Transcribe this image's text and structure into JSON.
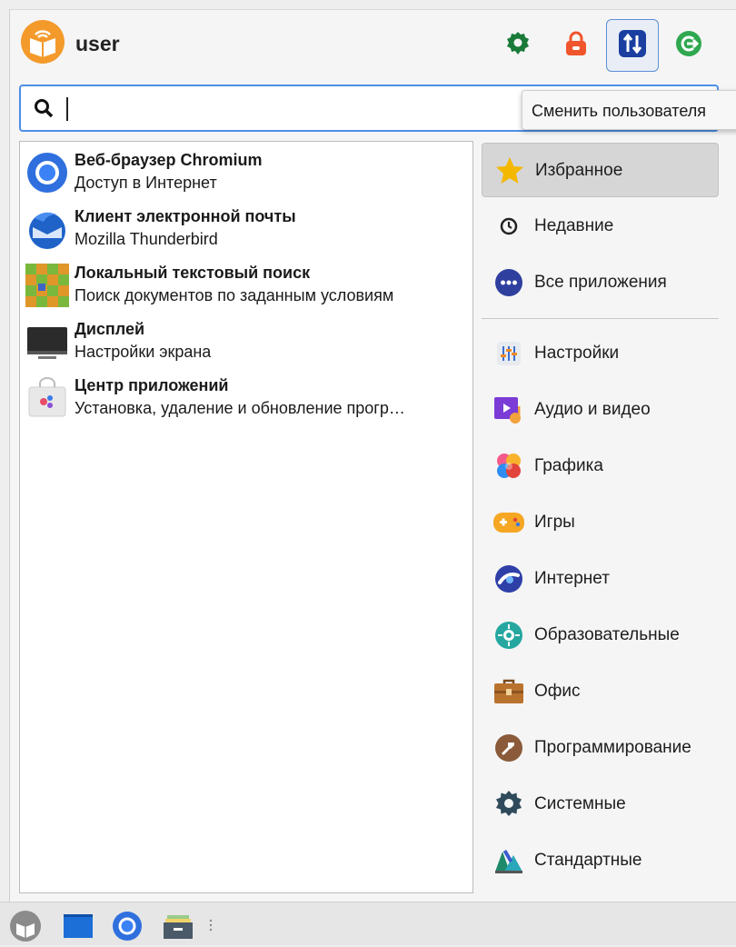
{
  "header": {
    "username": "user",
    "buttons": [
      {
        "icon": "settings-gear-icon",
        "color": "#1a7a3a"
      },
      {
        "icon": "lock-icon",
        "color": "#f0552c"
      },
      {
        "icon": "switch-user-icon",
        "color": "#1a3fa0"
      },
      {
        "icon": "logout-icon",
        "color": "#2fa84f"
      }
    ],
    "tooltip": "Сменить пользователя"
  },
  "search": {
    "value": "",
    "placeholder": ""
  },
  "apps": [
    {
      "name": "Веб-браузер Chromium",
      "description": "Доступ в Интернет",
      "icon": "chromium-icon"
    },
    {
      "name": "Клиент электронной почты",
      "description": "Mozilla Thunderbird",
      "icon": "thunderbird-icon"
    },
    {
      "name": "Локальный текстовый поиск",
      "description": "Поиск документов по заданным условиям",
      "icon": "recoll-icon"
    },
    {
      "name": "Дисплей",
      "description": "Настройки экрана",
      "icon": "display-icon"
    },
    {
      "name": "Центр приложений",
      "description": "Установка, удаление и обновление прогр…",
      "icon": "app-center-icon"
    }
  ],
  "categories_top": [
    {
      "label": "Избранное",
      "icon": "star-icon",
      "selected": true
    },
    {
      "label": "Недавние",
      "icon": "clock-icon"
    },
    {
      "label": "Все приложения",
      "icon": "all-apps-icon"
    }
  ],
  "categories": [
    {
      "label": "Настройки",
      "icon": "settings-icon"
    },
    {
      "label": "Аудио и видео",
      "icon": "multimedia-icon"
    },
    {
      "label": "Графика",
      "icon": "graphics-icon"
    },
    {
      "label": "Игры",
      "icon": "gamepad-icon"
    },
    {
      "label": "Интернет",
      "icon": "internet-icon"
    },
    {
      "label": "Образовательные",
      "icon": "education-icon"
    },
    {
      "label": "Офис",
      "icon": "office-icon"
    },
    {
      "label": "Программирование",
      "icon": "development-icon"
    },
    {
      "label": "Системные",
      "icon": "system-icon"
    },
    {
      "label": "Стандартные",
      "icon": "accessories-icon"
    }
  ],
  "taskbar": [
    {
      "icon": "menu-icon"
    },
    {
      "icon": "terminal-icon"
    },
    {
      "icon": "chromium-icon"
    },
    {
      "icon": "file-manager-icon"
    }
  ]
}
